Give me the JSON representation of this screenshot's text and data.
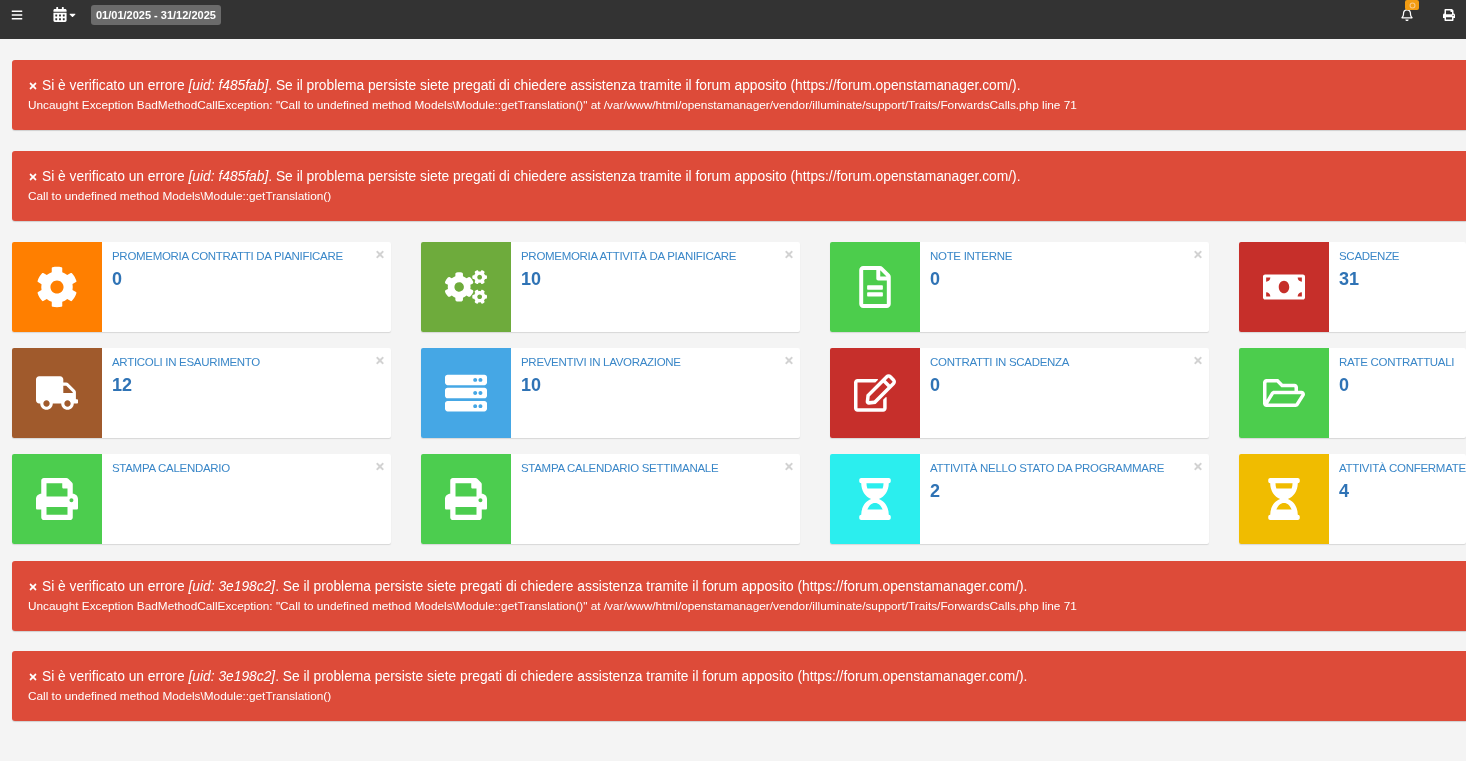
{
  "topbar": {
    "date_range": "01/01/2025 - 31/12/2025"
  },
  "alerts_top": [
    {
      "message": "Si è verificato un errore *[uid: f485fab]*. Se il problema persiste siete pregati di chiedere assistenza tramite il forum apposito (https://forum.openstamanager.com/).",
      "detail": "Uncaught Exception BadMethodCallException: \"Call to undefined method Models\\Module::getTranslation()\" at /var/www/html/openstamanager/vendor/illuminate/support/Traits/ForwardsCalls.php line 71"
    },
    {
      "message": "Si è verificato un errore *[uid: f485fab]*. Se il problema persiste siete pregati di chiedere assistenza tramite il forum apposito (https://forum.openstamanager.com/).",
      "detail": "Call to undefined method Models\\Module::getTranslation()"
    }
  ],
  "tiles": [
    {
      "title": "PROMEMORIA CONTRATTI DA PIANIFICARE",
      "value": "0",
      "color": "#ff7f00",
      "closable": true
    },
    {
      "title": "PROMEMORIA ATTIVITÀ DA PIANIFICARE",
      "value": "10",
      "color": "#6eab3c",
      "closable": true
    },
    {
      "title": "NOTE INTERNE",
      "value": "0",
      "color": "#4ccd4c",
      "closable": true
    },
    {
      "title": "SCADENZE",
      "value": "31",
      "color": "#c62f2a",
      "closable": false
    },
    {
      "title": "ARTICOLI IN ESAURIMENTO",
      "value": "12",
      "color": "#a05a2c",
      "closable": true
    },
    {
      "title": "PREVENTIVI IN LAVORAZIONE",
      "value": "10",
      "color": "#45a7e5",
      "closable": true
    },
    {
      "title": "CONTRATTI IN SCADENZA",
      "value": "0",
      "color": "#c62f2b",
      "closable": true
    },
    {
      "title": "RATE CONTRATTUALI",
      "value": "0",
      "color": "#4ccd4d",
      "closable": false
    },
    {
      "title": "STAMPA CALENDARIO",
      "color": "#4ccd4e",
      "closable": true
    },
    {
      "title": "STAMPA CALENDARIO SETTIMANALE",
      "color": "#4ccd4f",
      "closable": true
    },
    {
      "title": "ATTIVITÀ NELLO STATO DA PROGRAMMARE",
      "value": "2",
      "color": "#2beeee",
      "closable": true
    },
    {
      "title": "ATTIVITÀ CONFERMATE",
      "value": "4",
      "color": "#f0bc00",
      "closable": false
    }
  ],
  "alerts_bottom": [
    {
      "message": "Si è verificato un errore *[uid: 3e198c2]*. Se il problema persiste siete pregati di chiedere assistenza tramite il forum apposito (https://forum.openstamanager.com/).",
      "detail": "Uncaught Exception BadMethodCallException: \"Call to undefined method Models\\Module::getTranslation()\" at /var/www/html/openstamanager/vendor/illuminate/support/Traits/ForwardsCalls.php line 71"
    },
    {
      "message": "Si è verificato un errore *[uid: 3e198c2]*. Se il problema persiste siete pregati di chiedere assistenza tramite il forum apposito (https://forum.openstamanager.com/).",
      "detail": "Call to undefined method Models\\Module::getTranslation()"
    }
  ]
}
